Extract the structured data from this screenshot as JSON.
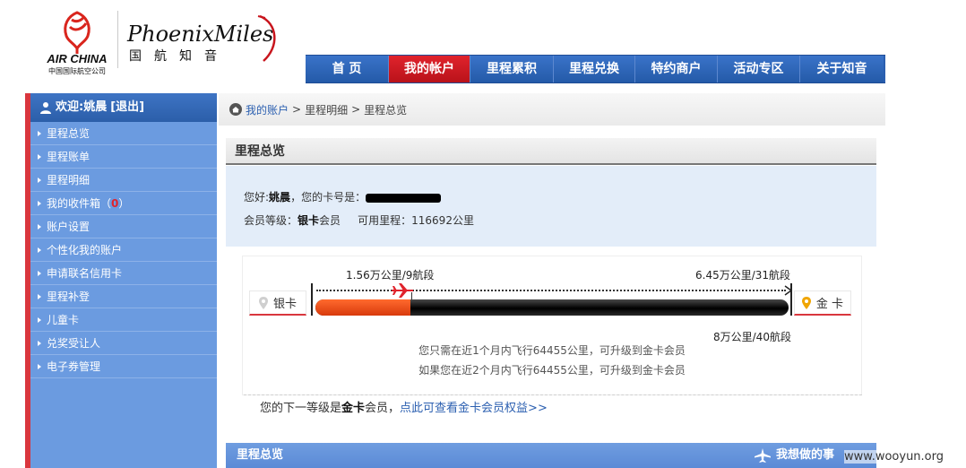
{
  "header": {
    "airchina_logo": "AIR CHINA 中国国际航空公司",
    "airchina_en": "AIR CHINA",
    "airchina_cn": "中国国际航空公司",
    "phoenix_title": "PhoenixMiles",
    "phoenix_sub": "国航知音"
  },
  "nav": {
    "items": [
      {
        "label": "首 页"
      },
      {
        "label": "我的帐户"
      },
      {
        "label": "里程累积"
      },
      {
        "label": "里程兑换"
      },
      {
        "label": "特约商户"
      },
      {
        "label": "活动专区"
      },
      {
        "label": "关于知音"
      }
    ],
    "active_index": 1
  },
  "sidebar": {
    "welcome": "欢迎:姚晨",
    "logout": "[退出]",
    "items": [
      {
        "label": "里程总览"
      },
      {
        "label": "里程账单"
      },
      {
        "label": "里程明细"
      },
      {
        "label": "我的收件箱（",
        "badge": "0",
        "suffix": "）"
      },
      {
        "label": "账户设置"
      },
      {
        "label": "个性化我的账户"
      },
      {
        "label": "申请联名信用卡"
      },
      {
        "label": "里程补登"
      },
      {
        "label": "儿童卡"
      },
      {
        "label": "兑奖受让人"
      },
      {
        "label": "电子券管理"
      }
    ]
  },
  "breadcrumb": {
    "home": "我的账户",
    "sep1": ">",
    "level2": "里程明细",
    "sep2": ">",
    "level3": "里程总览"
  },
  "overview": {
    "title": "里程总览",
    "greeting_prefix": "您好:",
    "name": "姚晨",
    "card_label": "，您的卡号是：",
    "level_label": "会员等级：",
    "level_value": "银卡",
    "level_suffix": "会员",
    "miles_label": "可用里程：",
    "miles_value": "116692公里"
  },
  "progress": {
    "current": "1.56万公里/9航段",
    "next_upper": "6.45万公里/31航段",
    "goal": "8万公里/40航段",
    "fill_fraction": 0.2,
    "silver_label": "银卡",
    "gold_label": "金 卡",
    "hint1": "您只需在近1个月内飞行64455公里，可升级到金卡会员",
    "hint2": "如果您在近2个月内飞行64455公里，可升级到金卡会员"
  },
  "next_level": {
    "prefix": "您的下一等级是",
    "level": "金卡",
    "suffix": "会员，",
    "link": "点此可查看金卡会员权益>>"
  },
  "bottom": {
    "title": "里程总览",
    "action": "我想做的事"
  },
  "watermark": "www.wooyun.org",
  "colors": {
    "nav_blue": "#2b5fb0",
    "nav_active_red": "#d0161f",
    "sidebar_blue": "#6b9be0",
    "progress_fill": "#ff6a2e"
  }
}
